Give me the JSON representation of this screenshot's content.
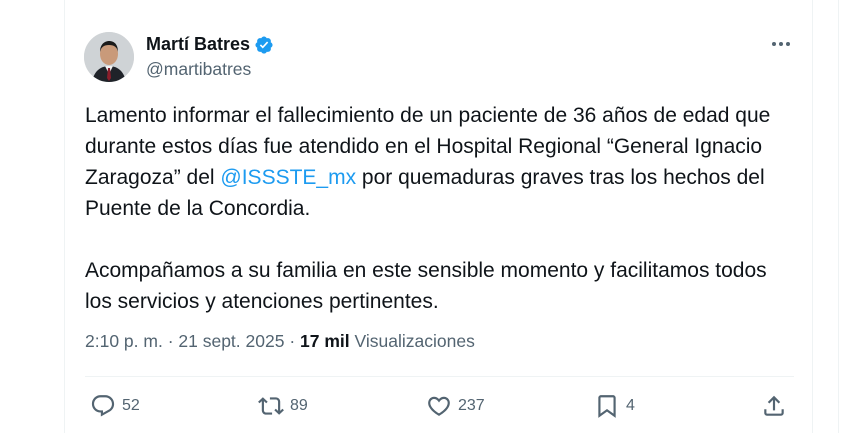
{
  "author": {
    "name": "Martí Batres",
    "handle": "@martibatres"
  },
  "tweet": {
    "p1_before": "Lamento informar el fallecimiento de un paciente de 36 años de edad que durante estos días fue atendido en el Hospital Regional “General Ignacio Zaragoza” del ",
    "mention": "@ISSSTE_mx",
    "p1_after": " por quemaduras graves tras los hechos del Puente de la Concordia.",
    "p2": "Acompañamos a su familia en este sensible momento y facilitamos todos los servicios y atenciones pertinentes."
  },
  "meta": {
    "time": "2:10 p. m.",
    "separator": " · ",
    "date": "21 sept. 2025",
    "views_count": "17 mil",
    "views_label": "Visualizaciones"
  },
  "actions": {
    "replies": "52",
    "reposts": "89",
    "likes": "237",
    "bookmarks": "4"
  },
  "colors": {
    "accent": "#1d9bf0",
    "secondary_text": "#536471",
    "primary_text": "#0f1419"
  },
  "icons": [
    "verified-badge-icon",
    "more-icon",
    "reply-icon",
    "repost-icon",
    "like-icon",
    "bookmark-icon",
    "share-icon"
  ]
}
